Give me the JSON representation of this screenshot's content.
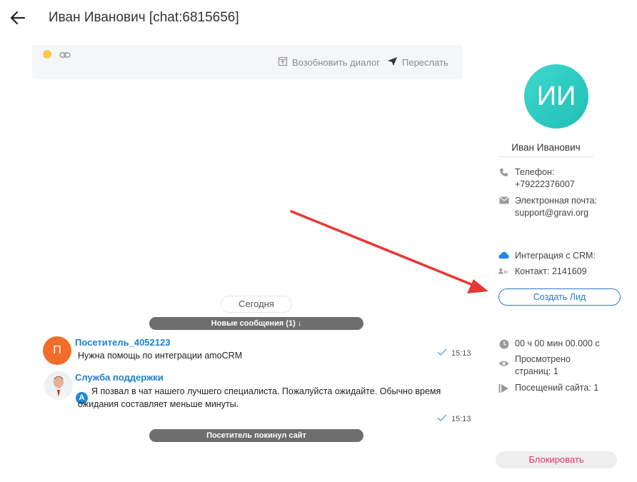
{
  "header": {
    "title": "Иван Иванович [chat:6815656]"
  },
  "toolbar": {
    "resume_label": "Возобновить диалог",
    "forward_label": "Переслать"
  },
  "chat": {
    "day_label": "Сегодня",
    "new_messages_label": "Новые сообщения (1) ↓",
    "visitor_left_label": "Посетитель покинул сайт",
    "messages": [
      {
        "author": "Посетитель_4052123",
        "avatar_letter": "П",
        "text": "Нужна помощь по интеграции amoCRM",
        "time": "15:13"
      },
      {
        "author": "Служба поддержки",
        "badge": "А",
        "text_line1": "Я позвал в чат нашего лучшего специалиста. Пожалуйста ожидайте. Обычно время",
        "text_line2": "ожидания составляет меньше минуты.",
        "time": "15:13"
      }
    ]
  },
  "contact": {
    "initials": "ИИ",
    "name": "Иван Иванович",
    "phone_label": "Телефон:",
    "phone": "+79222376007",
    "email_label": "Электронная почта:",
    "email": "support@gravi.org",
    "crm_label": "Интеграция с CRM:",
    "contact_id": "Контакт: 2141609",
    "create_lead_label": "Создать Лид",
    "time_on_site": "00 ч 00 мин 00.000 с",
    "pages_viewed_line1": "Просмотрено",
    "pages_viewed_line2": "страниц: 1",
    "site_visits": "Посещений сайта: 1",
    "block_label": "Блокировать"
  },
  "colors": {
    "accent_blue": "#1d7fd1",
    "avatar_teal": "#2fcfc6",
    "visitor_orange": "#f06e2a",
    "annotation_red": "#e53935",
    "block_pink": "#e0366b"
  }
}
